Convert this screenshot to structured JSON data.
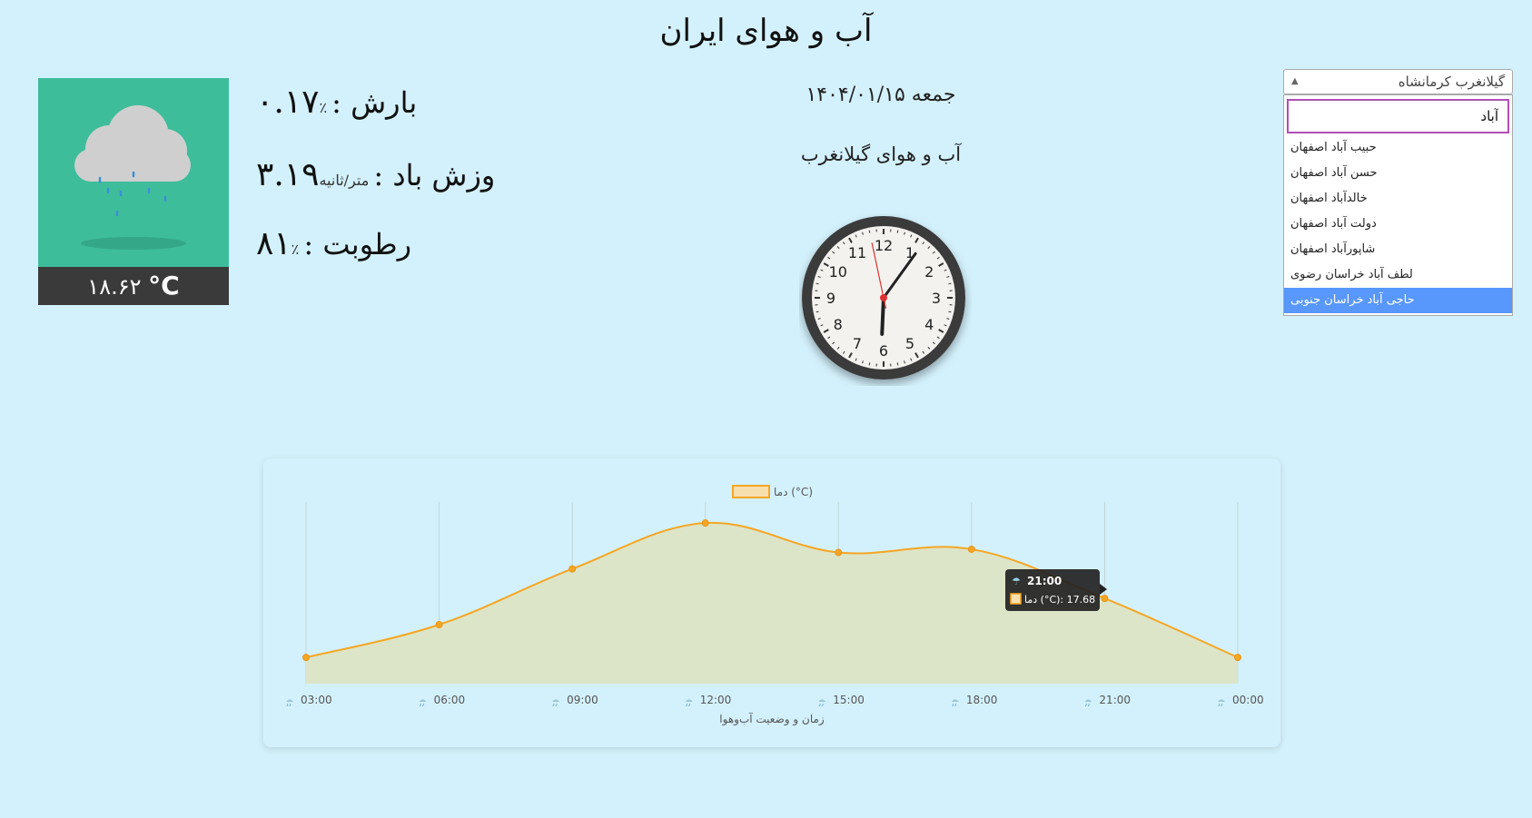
{
  "page": {
    "title": "آب و هوای ایران"
  },
  "weather": {
    "temperature": "۱۸.۶۲",
    "temp_unit": "°C",
    "precipitation_label": "بارش :",
    "precipitation_unit": "٪",
    "precipitation_value": "۰.۱۷",
    "wind_label": "وزش باد :",
    "wind_unit": "متر/ثانیه",
    "wind_value": "۳.۱۹",
    "humidity_label": "رطوبت :",
    "humidity_unit": "٪",
    "humidity_value": "۸۱",
    "icon": "rain-cloud-icon"
  },
  "date": {
    "text": "جمعه ۱۴۰۴/۰۱/۱۵"
  },
  "city": {
    "heading": "آب و هوای گیلانغرب"
  },
  "clock": {
    "numbers": [
      "12",
      "1",
      "2",
      "3",
      "4",
      "5",
      "6",
      "7",
      "8",
      "9",
      "10",
      "11"
    ],
    "hour": 6,
    "minute": 5,
    "second": 58
  },
  "city_select": {
    "selected": "گیلانغرب کرمانشاه",
    "search_value": "آباد",
    "options": [
      "حبیب آباد اصفهان",
      "حسن آباد اصفهان",
      "خالدآباد اصفهان",
      "دولت آباد اصفهان",
      "شاپورآباد اصفهان",
      "لطف آباد خراسان رضوی",
      "حاجی آباد خراسان جنوبی"
    ],
    "highlighted_index": 6
  },
  "chart_data": {
    "type": "area",
    "categories": [
      "03:00",
      "06:00",
      "09:00",
      "12:00",
      "15:00",
      "18:00",
      "21:00",
      "00:00"
    ],
    "series": [
      {
        "name": "دما (°C)",
        "values": [
          11.9,
          12.9,
          14.6,
          16.0,
          15.1,
          15.2,
          13.7,
          11.9
        ]
      }
    ],
    "xlabel": "زمان و وضعیت آب‌وهوا",
    "ylabel": "",
    "ylim": [
      11.1,
      16.5
    ],
    "grid": "vertical",
    "legend_position": "top",
    "colors": {
      "line": "#f5a623",
      "fill": "#dde5c8"
    },
    "tooltip": {
      "title": "21:00",
      "label": "دما (°C): 17.68"
    },
    "tick_icon": "rain-icon"
  }
}
